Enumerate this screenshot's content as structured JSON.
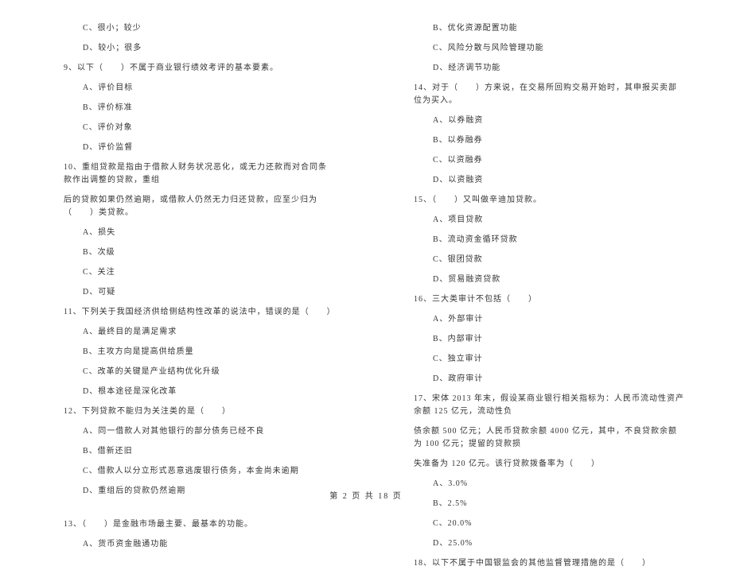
{
  "left_column": {
    "lines": [
      {
        "type": "option",
        "text": "C、很小；较少"
      },
      {
        "type": "option",
        "text": "D、较小；很多"
      },
      {
        "type": "question",
        "text": "9、以下（　　）不属于商业银行绩效考评的基本要素。"
      },
      {
        "type": "option",
        "text": "A、评价目标"
      },
      {
        "type": "option",
        "text": "B、评价标准"
      },
      {
        "type": "option",
        "text": "C、评价对象"
      },
      {
        "type": "option",
        "text": "D、评价监督"
      },
      {
        "type": "question",
        "text": "10、重组贷款是指由于借款人财务状况恶化，或无力还款而对合同条款作出调整的贷款，重组"
      },
      {
        "type": "continuation",
        "text": "后的贷款如果仍然逾期，或借款人仍然无力归还贷款，应至少归为（　　）类贷款。"
      },
      {
        "type": "option",
        "text": "A、损失"
      },
      {
        "type": "option",
        "text": "B、次级"
      },
      {
        "type": "option",
        "text": "C、关注"
      },
      {
        "type": "option",
        "text": "D、可疑"
      },
      {
        "type": "question",
        "text": "11、下列关于我国经济供给侧结构性改革的说法中，错误的是（　　）"
      },
      {
        "type": "option",
        "text": "A、最终目的是满足需求"
      },
      {
        "type": "option",
        "text": "B、主攻方向是提高供给质量"
      },
      {
        "type": "option",
        "text": "C、改革的关键是产业结构优化升级"
      },
      {
        "type": "option",
        "text": "D、根本途径是深化改革"
      },
      {
        "type": "question",
        "text": "12、下列贷款不能归为关注类的是（　　）"
      },
      {
        "type": "option",
        "text": "A、同一借款人对其他银行的部分债务已经不良"
      },
      {
        "type": "option",
        "text": "B、借新还旧"
      },
      {
        "type": "option",
        "text": "C、借款人以分立形式恶意逃废银行债务，本金尚未逾期"
      },
      {
        "type": "option",
        "text": "D、重组后的贷款仍然逾期"
      },
      {
        "type": "spacer",
        "text": ""
      },
      {
        "type": "question",
        "text": "13、（　　）是金融市场最主要、最基本的功能。"
      },
      {
        "type": "option",
        "text": "A、货币资金融通功能"
      }
    ]
  },
  "right_column": {
    "lines": [
      {
        "type": "option",
        "text": "B、优化资源配置功能"
      },
      {
        "type": "option",
        "text": "C、风险分散与风险管理功能"
      },
      {
        "type": "option",
        "text": "D、经济调节功能"
      },
      {
        "type": "question",
        "text": "14、对于（　　）方来说，在交易所回购交易开始时，其申报买卖部位为买入。"
      },
      {
        "type": "option",
        "text": "A、以券融资"
      },
      {
        "type": "option",
        "text": "B、以券融券"
      },
      {
        "type": "option",
        "text": "C、以资融券"
      },
      {
        "type": "option",
        "text": "D、以资融资"
      },
      {
        "type": "question",
        "text": "15、（　　）又叫做辛迪加贷款。"
      },
      {
        "type": "option",
        "text": "A、项目贷款"
      },
      {
        "type": "option",
        "text": "B、流动资金循环贷款"
      },
      {
        "type": "option",
        "text": "C、银团贷款"
      },
      {
        "type": "option",
        "text": "D、贸易融资贷款"
      },
      {
        "type": "question",
        "text": "16、三大类审计不包括（　　）"
      },
      {
        "type": "option",
        "text": "A、外部审计"
      },
      {
        "type": "option",
        "text": "B、内部审计"
      },
      {
        "type": "option",
        "text": "C、独立审计"
      },
      {
        "type": "option",
        "text": "D、政府审计"
      },
      {
        "type": "question",
        "text": "17、宋体 2013 年末，假设某商业银行相关指标为：人民币流动性资产余额 125 亿元，流动性负"
      },
      {
        "type": "continuation",
        "text": "债余额 500 亿元；人民币贷款余额 4000 亿元，其中，不良贷款余额为 100 亿元；提留的贷款损"
      },
      {
        "type": "continuation",
        "text": "失准备为 120 亿元。该行贷款拨备率为（　　）"
      },
      {
        "type": "option",
        "text": "A、3.0%"
      },
      {
        "type": "option",
        "text": "B、2.5%"
      },
      {
        "type": "option",
        "text": "C、20.0%"
      },
      {
        "type": "option",
        "text": "D、25.0%"
      },
      {
        "type": "question",
        "text": "18、以下不属于中国银监会的其他监督管理措施的是（　　）"
      }
    ]
  },
  "page_footer": "第 2 页 共 18 页"
}
